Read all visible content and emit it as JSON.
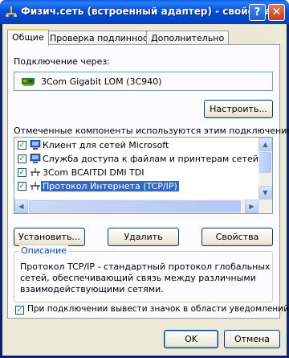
{
  "window": {
    "title": "Физич.сеть (встроенный адаптер) - свойства",
    "help_glyph": "?",
    "close_glyph": "✕"
  },
  "tabs": [
    {
      "label": "Общие",
      "active": true
    },
    {
      "label": "Проверка подлинности",
      "active": false
    },
    {
      "label": "Дополнительно",
      "active": false
    }
  ],
  "connect": {
    "label": "Подключение через:",
    "adapter": "3Com Gigabit LOM (3C940)",
    "configure_button": "Настроить..."
  },
  "components": {
    "label": "Отмеченные компоненты используются этим подключением:",
    "items": [
      {
        "label": "Клиент для сетей Microsoft",
        "checked": true,
        "icon": "network-client-icon",
        "selected": false
      },
      {
        "label": "Служба доступа к файлам и принтерам сетей Micro",
        "checked": true,
        "icon": "file-printer-sharing-icon",
        "selected": false
      },
      {
        "label": "3Com BCAITDI DMI TDI",
        "checked": true,
        "icon": "network-protocol-icon",
        "selected": false
      },
      {
        "label": "Протокол Интернета (TCP/IP)",
        "checked": true,
        "icon": "network-protocol-icon",
        "selected": true
      }
    ],
    "install_button": "Установить...",
    "remove_button": "Удалить",
    "properties_button": "Свойства"
  },
  "description": {
    "title": "Описание",
    "text_lines": [
      "Протокол TCP/IP - стандартный протокол глобальных",
      "сетей, обеспечивающий связь между различными",
      "взаимодействующими сетями."
    ]
  },
  "notify": {
    "label": "При подключении вывести значок в области уведомлений",
    "checked": true
  },
  "footer": {
    "ok_button": "OK",
    "cancel_button": "Отмена"
  },
  "colors": {
    "titlebar": "#0050d8",
    "selection": "#316ac5",
    "group_title": "#0046d5",
    "dialog_bg": "#ece9d8"
  }
}
